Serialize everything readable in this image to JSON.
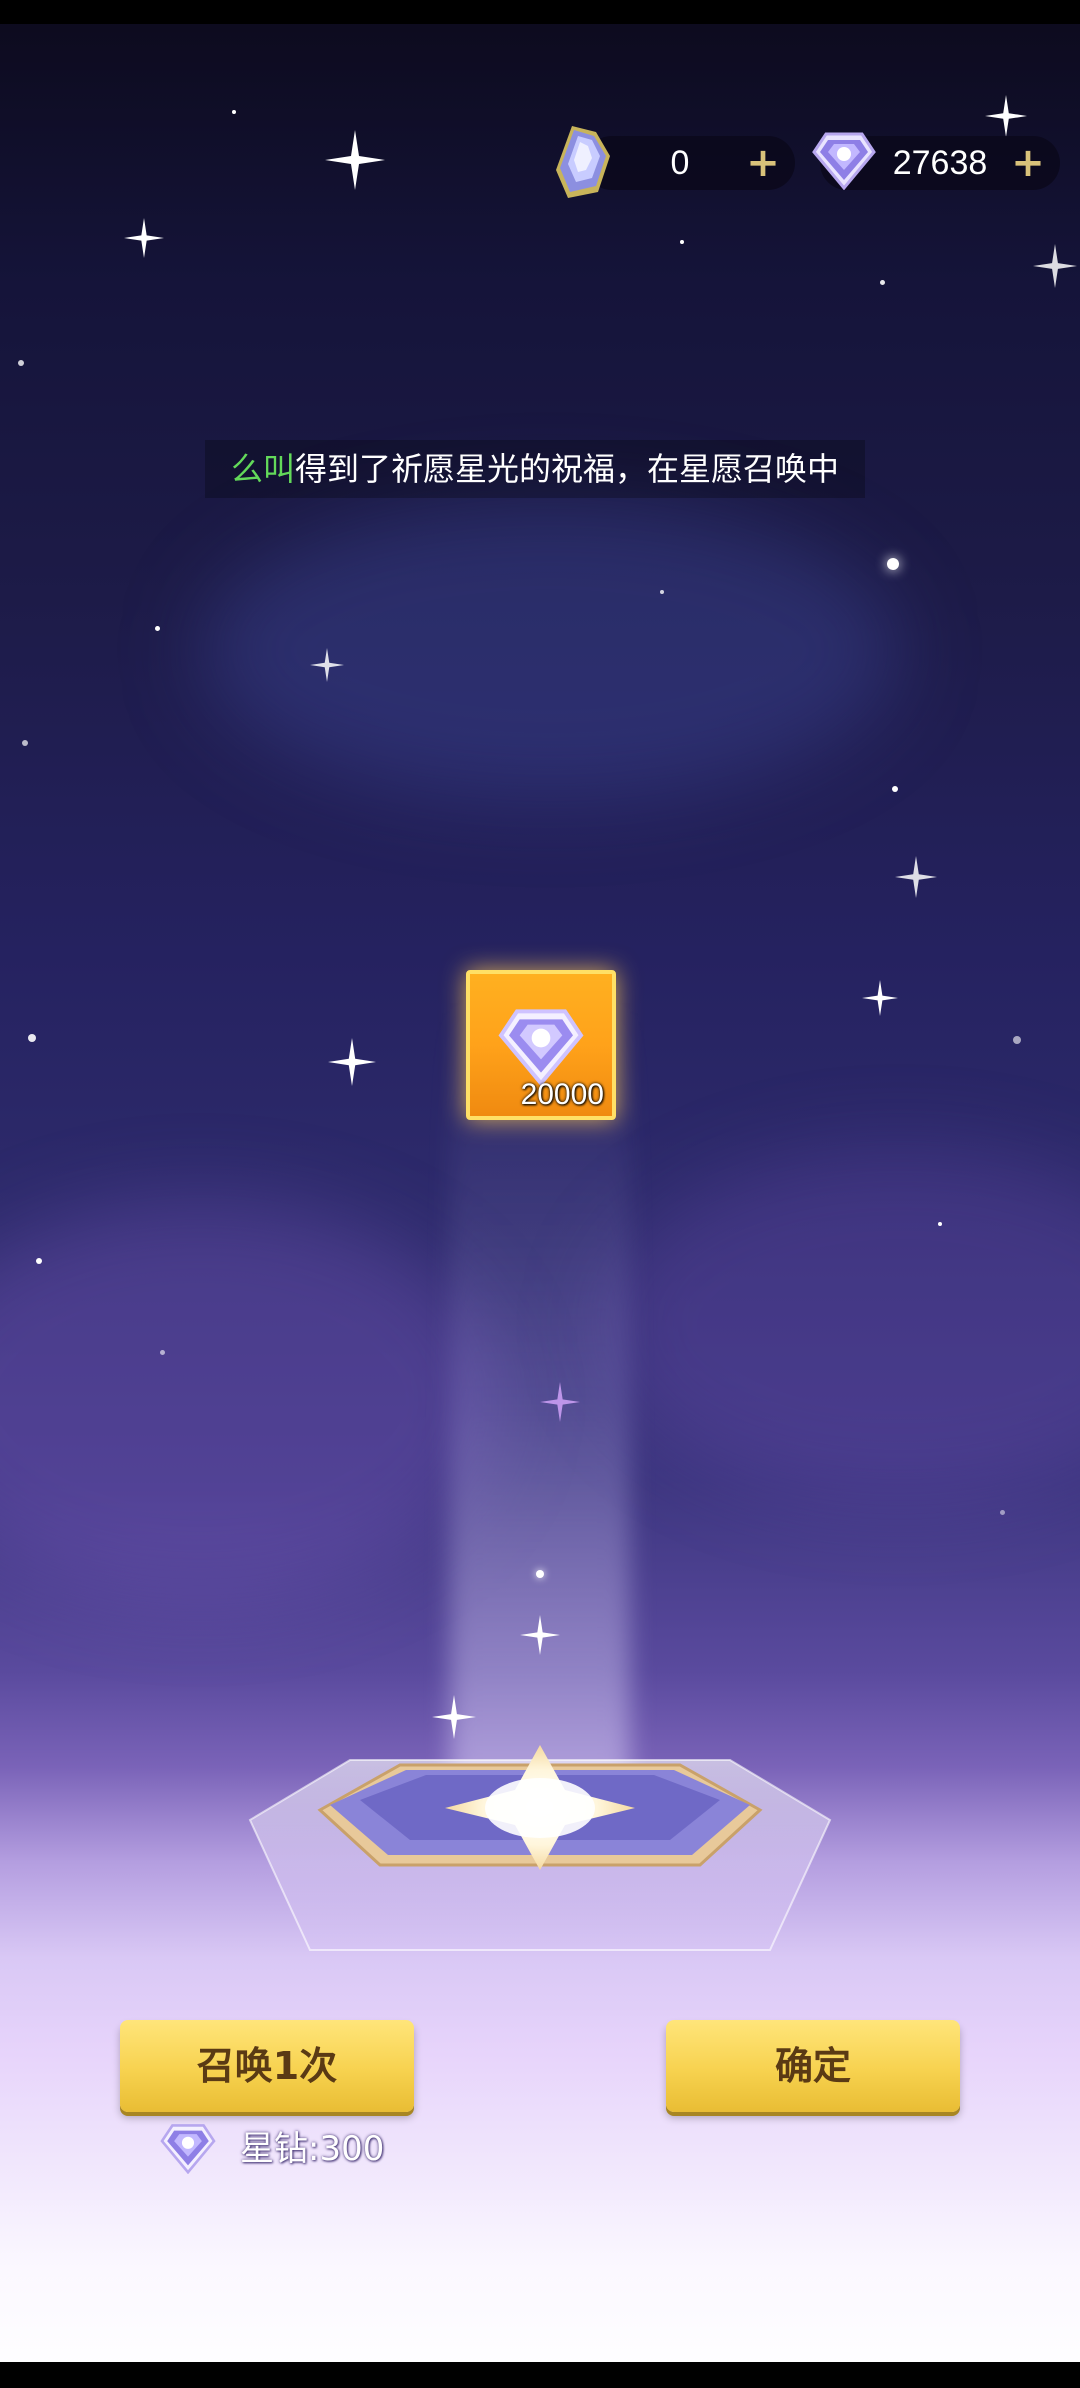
{
  "status_bar": {},
  "currencies": {
    "wish_crystal": {
      "value": "0",
      "icon": "purple-crystal-icon"
    },
    "star_diamond": {
      "value": "27638",
      "icon": "diamond-icon"
    }
  },
  "message": {
    "player_name": "么叫",
    "text": "得到了祈愿星光的祝福，在星愿召唤中"
  },
  "reward": {
    "icon": "diamond-icon",
    "amount": "20000"
  },
  "buttons": {
    "summon_once": "召唤1次",
    "confirm": "确定"
  },
  "cost": {
    "icon": "diamond-icon",
    "text": "星钻:300"
  },
  "colors": {
    "player_name": "#63d95a",
    "button_gold": "#f7d24f",
    "reward_orange": "#ffa21a"
  }
}
